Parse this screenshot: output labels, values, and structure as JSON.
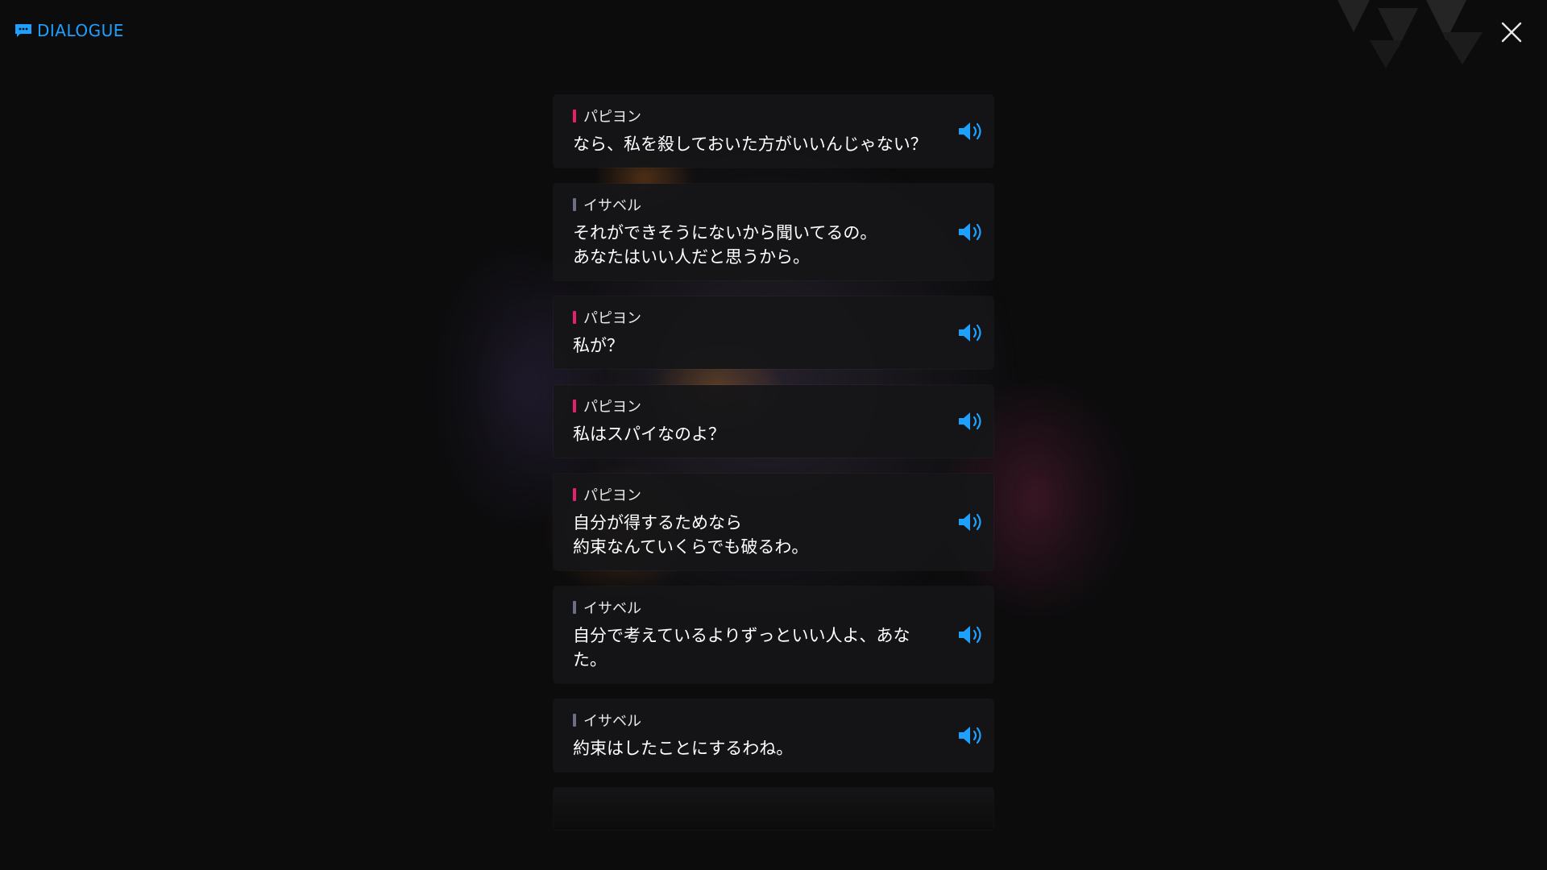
{
  "header": {
    "title": "DIALOGUE",
    "icon": "chat-bubble-icon"
  },
  "close": {
    "icon": "close-icon"
  },
  "colors": {
    "accent": "#1ea0ff",
    "speaker_papillon": "#e8206c",
    "speaker_isabel": "#6a6f86"
  },
  "entries": [
    {
      "speaker": "パピヨン",
      "speaker_color": "#e8206c",
      "text": "なら、私を殺しておいた方がいいんじゃない？",
      "audio_icon": "speaker-icon"
    },
    {
      "speaker": "イサベル",
      "speaker_color": "#6a6f86",
      "text": "それができそうにないから聞いてるの。\nあなたはいい人だと思うから。",
      "audio_icon": "speaker-icon"
    },
    {
      "speaker": "パピヨン",
      "speaker_color": "#e8206c",
      "text": "私が？",
      "audio_icon": "speaker-icon"
    },
    {
      "speaker": "パピヨン",
      "speaker_color": "#e8206c",
      "text": "私はスパイなのよ？",
      "audio_icon": "speaker-icon"
    },
    {
      "speaker": "パピヨン",
      "speaker_color": "#e8206c",
      "text": "自分が得するためなら\n約束なんていくらでも破るわ。",
      "audio_icon": "speaker-icon"
    },
    {
      "speaker": "イサベル",
      "speaker_color": "#6a6f86",
      "text": "自分で考えているよりずっといい人よ、あなた。",
      "audio_icon": "speaker-icon"
    },
    {
      "speaker": "イサベル",
      "speaker_color": "#6a6f86",
      "text": "約束はしたことにするわね。",
      "audio_icon": "speaker-icon"
    }
  ]
}
